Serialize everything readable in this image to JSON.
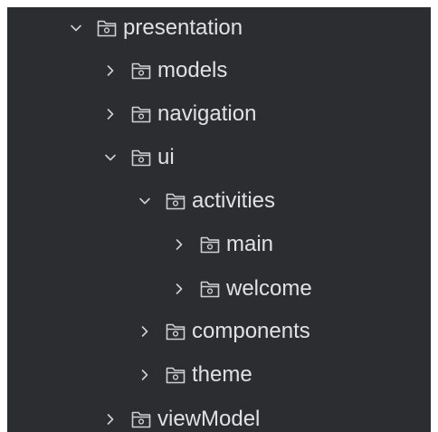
{
  "project_tree": {
    "items": [
      {
        "label": "presentation",
        "expanded": true,
        "depth": 0
      },
      {
        "label": "models",
        "expanded": false,
        "depth": 1
      },
      {
        "label": "navigation",
        "expanded": false,
        "depth": 1
      },
      {
        "label": "ui",
        "expanded": true,
        "depth": 1
      },
      {
        "label": "activities",
        "expanded": true,
        "depth": 2
      },
      {
        "label": "main",
        "expanded": false,
        "depth": 3
      },
      {
        "label": "welcome",
        "expanded": false,
        "depth": 3
      },
      {
        "label": "components",
        "expanded": false,
        "depth": 2
      },
      {
        "label": "theme",
        "expanded": false,
        "depth": 2
      },
      {
        "label": "viewModel",
        "expanded": false,
        "depth": 1
      }
    ],
    "icons": {
      "expanded": "chevron-down-icon",
      "collapsed": "chevron-right-icon",
      "folder": "package-folder-icon"
    },
    "colors": {
      "background": "#2b2d30",
      "text": "#dfe1e5",
      "icon": "#ced0d6"
    }
  }
}
